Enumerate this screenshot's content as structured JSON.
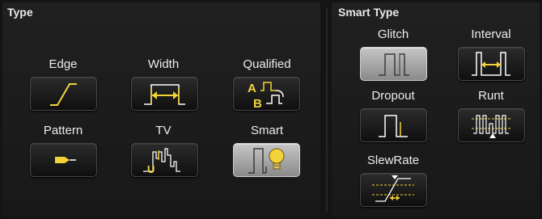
{
  "type_section": {
    "title": "Type",
    "buttons": [
      {
        "label": "Edge",
        "icon": "edge-icon",
        "selected": false
      },
      {
        "label": "Width",
        "icon": "width-icon",
        "selected": false
      },
      {
        "label": "Qualified",
        "icon": "qualified-icon",
        "selected": false
      },
      {
        "label": "Pattern",
        "icon": "pattern-icon",
        "selected": false
      },
      {
        "label": "TV",
        "icon": "tv-icon",
        "selected": false
      },
      {
        "label": "Smart",
        "icon": "smart-icon",
        "selected": true
      }
    ]
  },
  "smart_type_section": {
    "title": "Smart Type",
    "buttons": [
      {
        "label": "Glitch",
        "icon": "glitch-icon",
        "selected": true
      },
      {
        "label": "Interval",
        "icon": "interval-icon",
        "selected": false
      },
      {
        "label": "Dropout",
        "icon": "dropout-icon",
        "selected": false
      },
      {
        "label": "Runt",
        "icon": "runt-icon",
        "selected": false
      },
      {
        "label": "SlewRate",
        "icon": "slewrate-icon",
        "selected": false
      }
    ]
  },
  "icon_glyphs": {
    "qualified_a": "A",
    "qualified_b": "B",
    "tv_u": "U"
  },
  "colors": {
    "accent": "#f2d33a",
    "background": "#141414",
    "selected": "#b0b0b0",
    "text": "#ececec"
  }
}
